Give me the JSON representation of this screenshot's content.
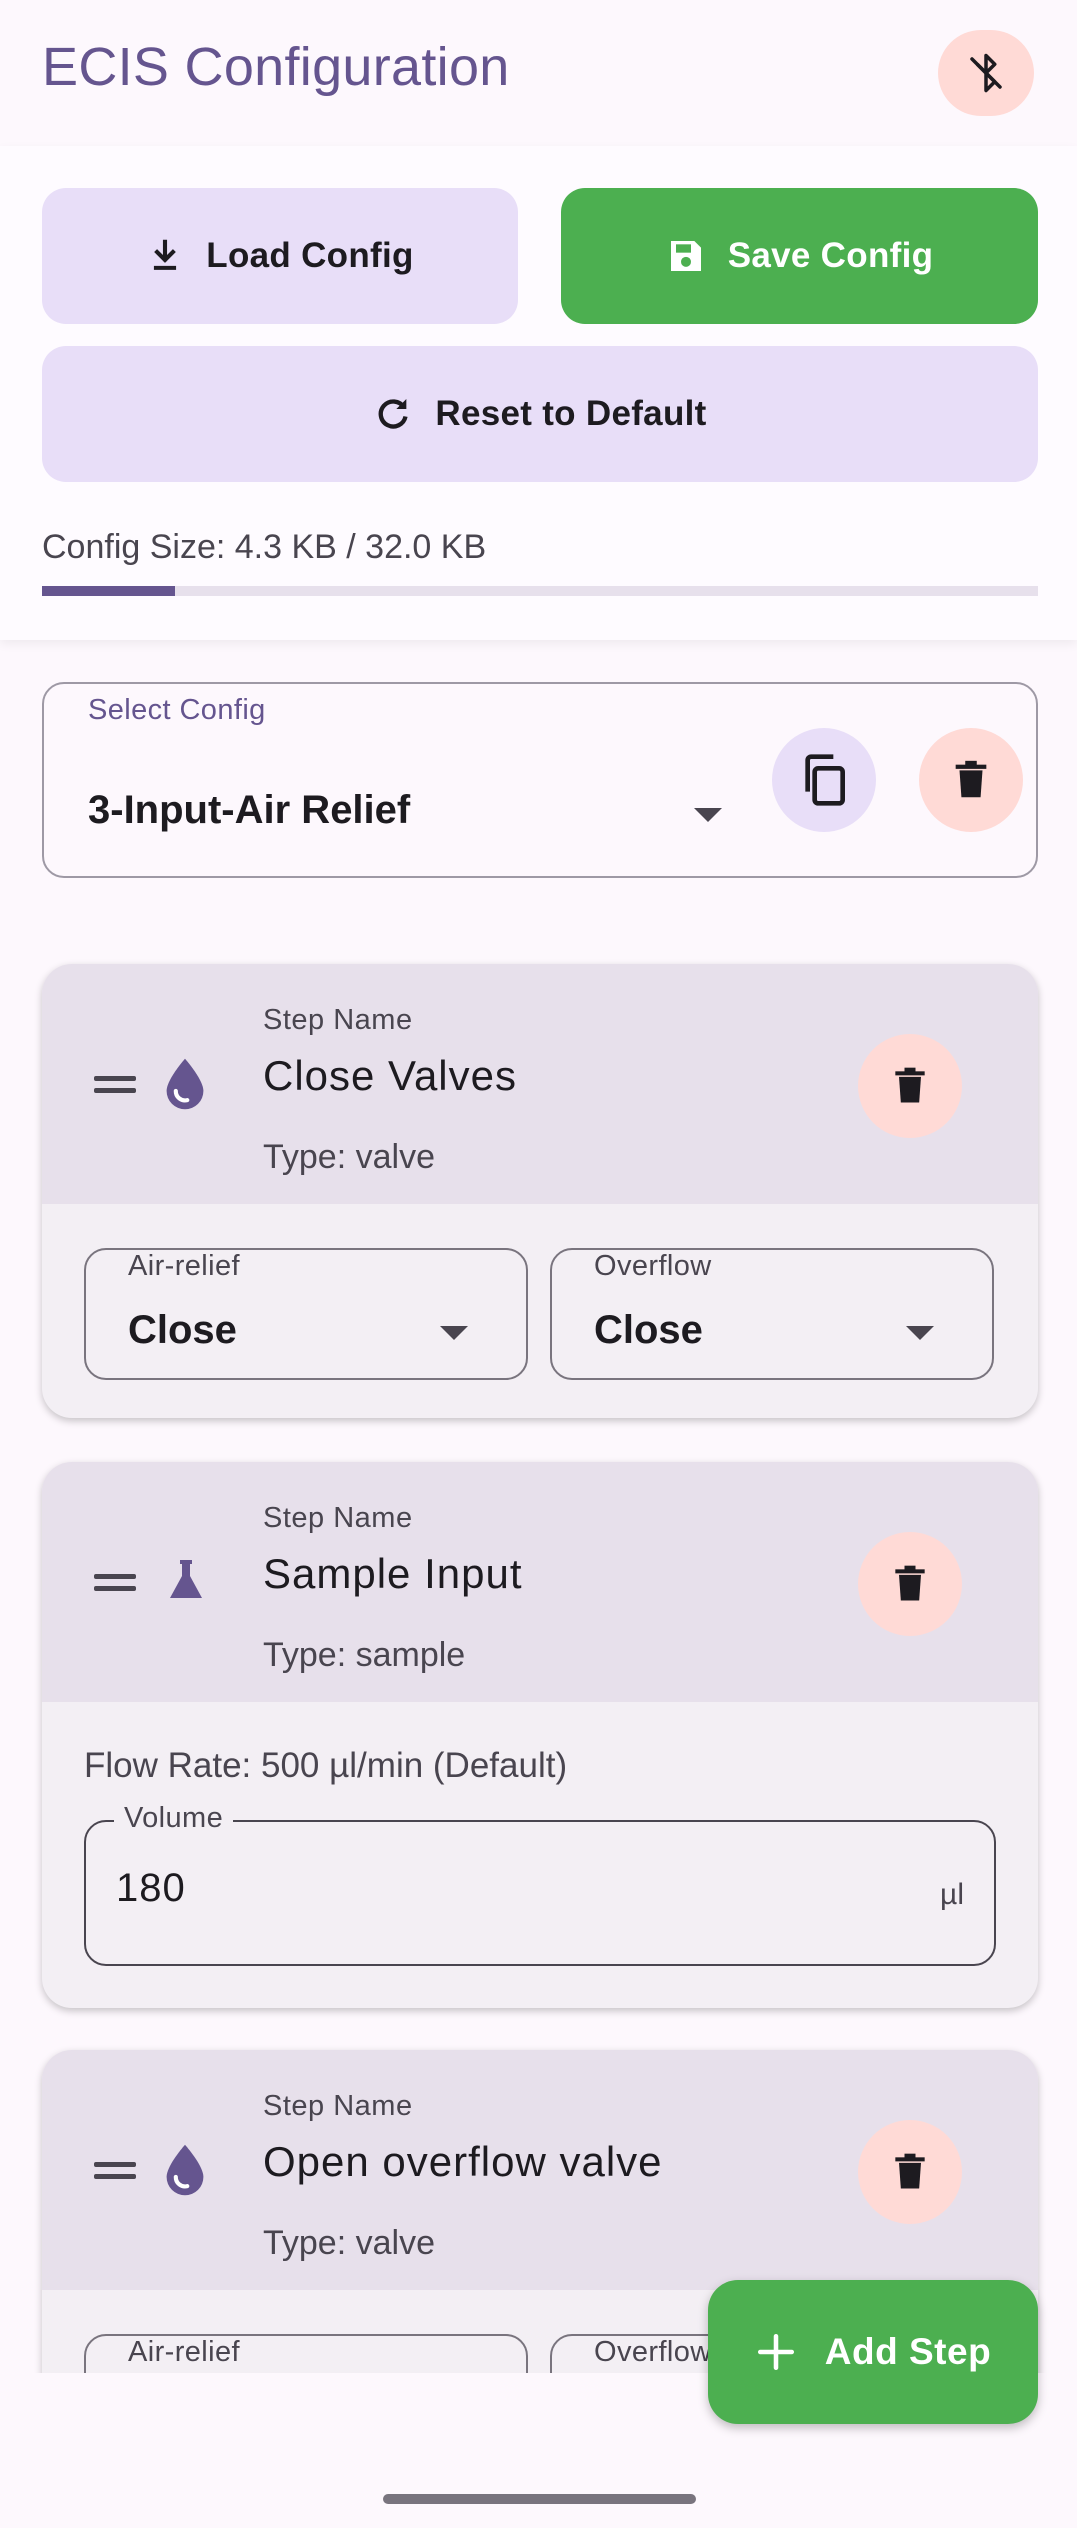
{
  "app": {
    "title": "ECIS Configuration",
    "bluetooth_icon": "bluetooth-disabled-icon"
  },
  "toolbar": {
    "load_label": "Load Config",
    "save_label": "Save Config",
    "reset_label": "Reset to Default"
  },
  "config_size": {
    "text": "Config Size: 4.3 KB / 32.0 KB",
    "used_fraction": 0.134
  },
  "select_config": {
    "label": "Select Config",
    "value": "3-Input-Air Relief"
  },
  "steps": [
    {
      "name_label": "Step Name",
      "name": "Close Valves",
      "type_text": "Type: valve",
      "icon": "water-drop-icon",
      "valves": [
        {
          "label": "Air-relief",
          "value": "Close"
        },
        {
          "label": "Overflow",
          "value": "Close"
        }
      ]
    },
    {
      "name_label": "Step Name",
      "name": "Sample Input",
      "type_text": "Type: sample",
      "icon": "flask-icon",
      "flow_rate": "Flow Rate: 500 µl/min (Default)",
      "volume_label": "Volume",
      "volume_value": "180",
      "volume_unit": "µl"
    },
    {
      "name_label": "Step Name",
      "name": "Open overflow valve",
      "type_text": "Type: valve",
      "icon": "water-drop-icon",
      "valves": [
        {
          "label": "Air-relief",
          "value": ""
        },
        {
          "label": "Overflow",
          "value": ""
        }
      ]
    }
  ],
  "fab": {
    "label": "Add Step"
  },
  "colors": {
    "primary": "#65558f",
    "success": "#4caf50",
    "error_container": "#ffdad6",
    "secondary_container": "#e8def8"
  }
}
